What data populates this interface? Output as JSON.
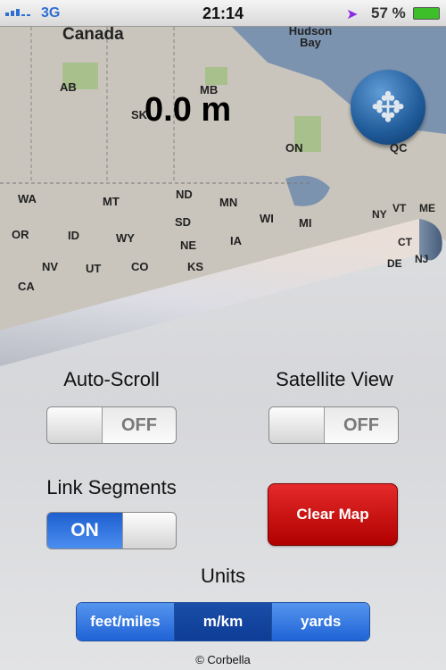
{
  "status_bar": {
    "network": "3G",
    "time": "21:14",
    "battery": "57 %",
    "signal_bars": 3,
    "icons": [
      "signal-icon",
      "location-arrow-icon",
      "battery-charging-icon"
    ]
  },
  "map": {
    "distance": "0.0 m",
    "pan_button_icon": "move-arrows-icon",
    "labels": [
      "Canada",
      "Hudson Bay",
      "AB",
      "SK",
      "MB",
      "ON",
      "QC",
      "WA",
      "MT",
      "ND",
      "MN",
      "WI",
      "MI",
      "OR",
      "ID",
      "WY",
      "SD",
      "NE",
      "IA",
      "NV",
      "UT",
      "CO",
      "KS",
      "CA",
      "VT",
      "ME",
      "NY",
      "CT",
      "NJ",
      "DE"
    ]
  },
  "settings": {
    "auto_scroll": {
      "label": "Auto-Scroll",
      "state": "OFF"
    },
    "satellite_view": {
      "label": "Satellite View",
      "state": "OFF"
    },
    "link_segments": {
      "label": "Link Segments",
      "state": "ON"
    },
    "clear_map": "Clear Map",
    "units": {
      "label": "Units",
      "options": [
        "feet/miles",
        "m/km",
        "yards"
      ],
      "selected": "m/km"
    }
  },
  "footer": "© Corbella",
  "colors": {
    "toggle_on": "#2f72e0",
    "clear_button": "#cc0a0a",
    "segment_selected": "#123f96",
    "segment": "#3b7fe6"
  }
}
